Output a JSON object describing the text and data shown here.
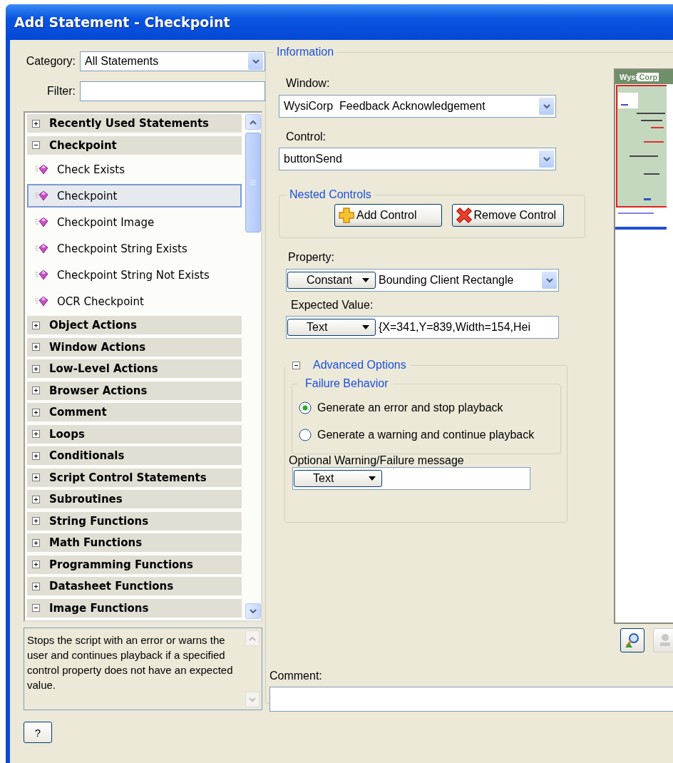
{
  "window": {
    "title": "Add Statement - Checkpoint"
  },
  "category": {
    "label": "Category:",
    "value": "All Statements"
  },
  "filter": {
    "label": "Filter:"
  },
  "statements": [
    {
      "kind": "group",
      "label": "Recently Used Statements",
      "expanded": false
    },
    {
      "kind": "group",
      "label": "Checkpoint",
      "expanded": true,
      "children": [
        {
          "kind": "statement",
          "label": "Check Exists",
          "selected": false
        },
        {
          "kind": "statement",
          "label": "Checkpoint",
          "selected": true
        },
        {
          "kind": "statement",
          "label": "Checkpoint Image",
          "selected": false
        },
        {
          "kind": "statement",
          "label": "Checkpoint String Exists",
          "selected": false
        },
        {
          "kind": "statement",
          "label": "Checkpoint String Not Exists",
          "selected": false
        },
        {
          "kind": "statement",
          "label": "OCR Checkpoint",
          "selected": false
        }
      ]
    },
    {
      "kind": "group",
      "label": "Object Actions",
      "expanded": false
    },
    {
      "kind": "group",
      "label": "Window Actions",
      "expanded": false
    },
    {
      "kind": "group",
      "label": "Low-Level Actions",
      "expanded": false
    },
    {
      "kind": "group",
      "label": "Browser Actions",
      "expanded": false
    },
    {
      "kind": "group",
      "label": "Comment",
      "expanded": false
    },
    {
      "kind": "group",
      "label": "Loops",
      "expanded": false
    },
    {
      "kind": "group",
      "label": "Conditionals",
      "expanded": false
    },
    {
      "kind": "group",
      "label": "Script Control Statements",
      "expanded": false
    },
    {
      "kind": "group",
      "label": "Subroutines",
      "expanded": false
    },
    {
      "kind": "group",
      "label": "String Functions",
      "expanded": false
    },
    {
      "kind": "group",
      "label": "Math Functions",
      "expanded": false
    },
    {
      "kind": "group",
      "label": "Programming Functions",
      "expanded": false
    },
    {
      "kind": "group",
      "label": "Datasheet Functions",
      "expanded": false
    },
    {
      "kind": "group",
      "label": "Image Functions",
      "expanded": true
    }
  ],
  "description": "Stops the script with an error or warns the user and continues playback if a specified control property does not have an expected value.",
  "help_button": "?",
  "information": {
    "title": "Information",
    "window": {
      "label": "Window:",
      "value": "WysiCorp  Feedback Acknowledgement"
    },
    "control": {
      "label": "Control:",
      "value": "buttonSend"
    },
    "nested_controls": {
      "title": "Nested Controls",
      "buttons": [
        {
          "kind": "add",
          "label": "Add Control"
        },
        {
          "kind": "remove",
          "label": "Remove Control"
        }
      ]
    },
    "property": {
      "label": "Property:",
      "mode": "Constant",
      "value": "Bounding Client Rectangle"
    },
    "expected_value": {
      "label": "Expected Value:",
      "mode": "Text",
      "value": "{X=341,Y=839,Width=154,Hei"
    },
    "advanced_options": {
      "title": "Advanced Options",
      "expanded": true,
      "failure_behavior": {
        "title": "Failure Behavior",
        "options": [
          {
            "label": "Generate an error and stop playback",
            "selected": true
          },
          {
            "label": "Generate a warning and continue playback",
            "selected": false
          }
        ]
      },
      "message": {
        "label": "Optional Warning/Failure message",
        "mode": "Text"
      }
    },
    "preview": {
      "title_parts": [
        "Wysi",
        "Corp"
      ]
    },
    "comment": {
      "label": "Comment:"
    }
  }
}
